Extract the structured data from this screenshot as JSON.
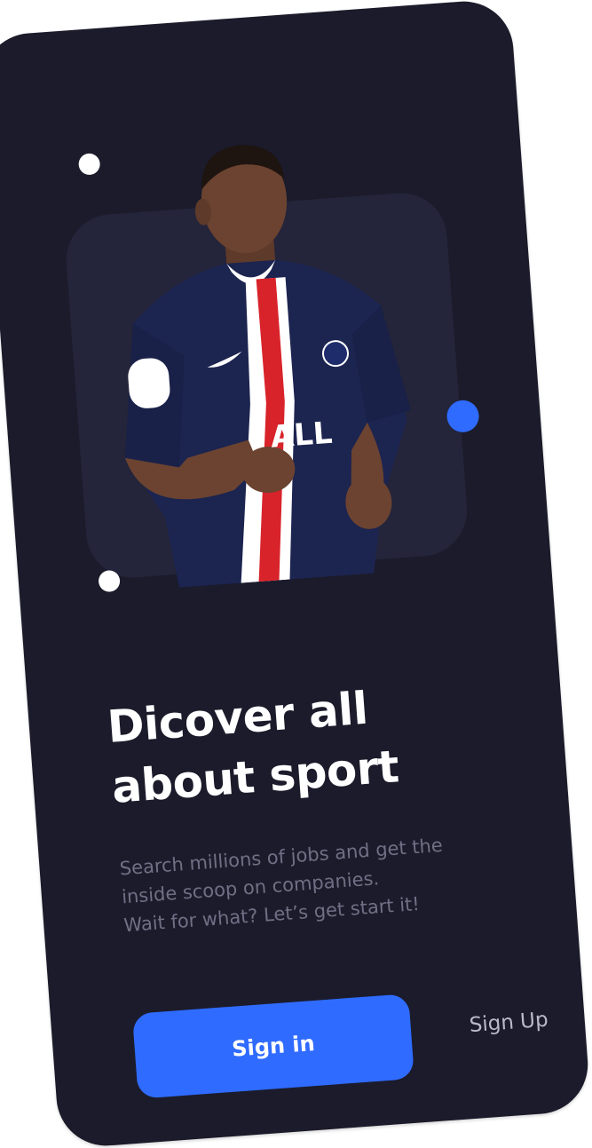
{
  "onboarding": {
    "headline": "Dicover all about sport",
    "description": "Search millions of jobs and get the\ninside scoop on companies.\nWait for what? Let’s get start it!",
    "primary_button": "Sign in",
    "secondary_link": "Sign Up"
  },
  "hero": {
    "image_semantic": "football-player-photo",
    "jersey_text": "ALL",
    "colors": {
      "jersey": "#1c2450",
      "stripe_red": "#d8232a",
      "stripe_white": "#ffffff",
      "skin": "#6b4330"
    }
  },
  "theme": {
    "background": "#1b1b2b",
    "card": "#24243a",
    "accent": "#2f6bff",
    "muted_text": "#6f7085"
  }
}
